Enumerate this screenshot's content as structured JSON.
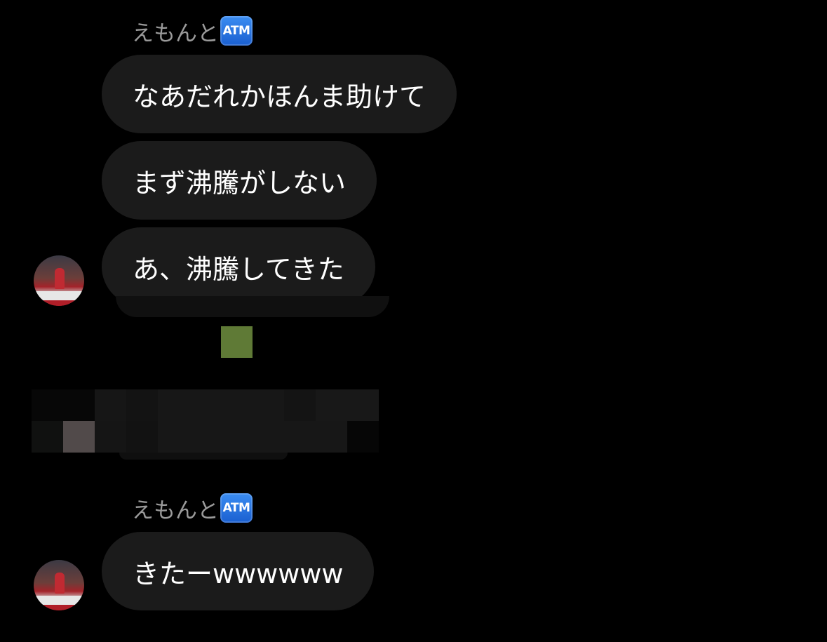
{
  "chat": {
    "sender_name": "えもんと",
    "sender_badge": "ATM",
    "messages": [
      "なあだれかほんま助けて",
      "まず沸騰がしない",
      "あ、沸騰してきた",
      "きたーwwwwww"
    ]
  },
  "colors": {
    "background": "#000000",
    "bubble": "#1b1b1b",
    "sender_name": "#9a9a9a",
    "atm_badge": "#2f7de8"
  }
}
